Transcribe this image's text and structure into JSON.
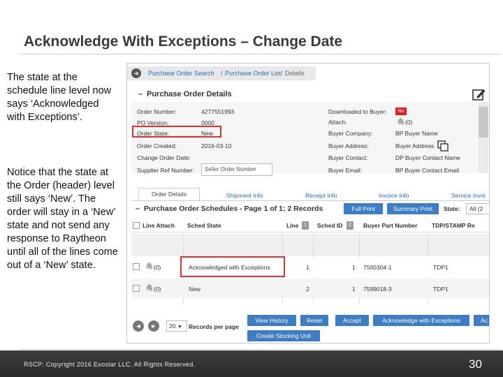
{
  "slide": {
    "title": "Acknowledge With Exceptions – Change Date",
    "note_1": "The state at the schedule line level now says ‘Acknowledged with Exceptions’.",
    "note_2": "Notice that the state at the Order (header) level still says ‘New’. The order will stay in a ‘New’ state and not send any response to Raytheon until all of the lines come out of a ‘New’ state.",
    "footer": "RSCP: Copyright 2016 Exostar LLC. All Rights Reserved.",
    "page_number": "30"
  },
  "breadcrumb": {
    "item_1": "Purchase Order Search",
    "separator": "/",
    "item_2": "Purchase Order List",
    "current": "Details"
  },
  "details": {
    "heading": "Purchase Order Details",
    "left_fields": [
      {
        "label": "Order Number:",
        "value": "4277551993"
      },
      {
        "label": "PO Version:",
        "value": "0000"
      },
      {
        "label": "Order State:",
        "value": "New"
      },
      {
        "label": "Order Created:",
        "value": "2016-03-10"
      },
      {
        "label": "Change Order Date:",
        "value": ""
      },
      {
        "label": "Supplier Ref Number:",
        "value": ""
      }
    ],
    "supplier_ref_placeholder": "Seller Order Number",
    "right_fields": [
      {
        "label": "Downloaded to Buyer:",
        "value": ""
      },
      {
        "label": "Attach:",
        "value": "(0)"
      },
      {
        "label": "Buyer Company:",
        "value": "BP Buyer Name"
      },
      {
        "label": "Buyer Address:",
        "value": "Buyer Address"
      },
      {
        "label": "Buyer Contact:",
        "value": "DP Buyer Contact Name"
      },
      {
        "label": "Buyer Email:",
        "value": "BP Buyer Contact Email"
      }
    ],
    "downloaded_badge": "No"
  },
  "tabs": [
    "Order Details",
    "Shipment Info",
    "Receipt Info",
    "Invoice Info",
    "Service Invoi"
  ],
  "schedules": {
    "heading": "Purchase Order Schedules - Page 1 of 1; 2 Records",
    "full_print": "Full Print",
    "summary_print": "Summary Print",
    "state_label": "State:",
    "state_value": "All (2",
    "columns": [
      "Line Attach",
      "Sched State",
      "Line",
      "Sched ID",
      "Buyer Part Number",
      "TDP/STAMP Re"
    ],
    "sort_icons": [
      "1",
      "2"
    ],
    "rows": [
      {
        "attach": "(0)",
        "state": "Acknowledged with Exceptions",
        "line": "1",
        "sched_id": "1",
        "part": "7500304-1",
        "tdp": "TDP1"
      },
      {
        "attach": "(0)",
        "state": "New",
        "line": "2",
        "sched_id": "1",
        "part": "7599018-3",
        "tdp": "TDP1"
      }
    ]
  },
  "pager": {
    "page_size": "20",
    "label": "Records per page"
  },
  "actions": {
    "view_history": "View History",
    "reset": "Reset",
    "accept": "Accept",
    "ack_exceptions": "Acknowledge with Exceptions",
    "ack_more": "Ac",
    "create_stocking": "Create Stocking Unit"
  }
}
